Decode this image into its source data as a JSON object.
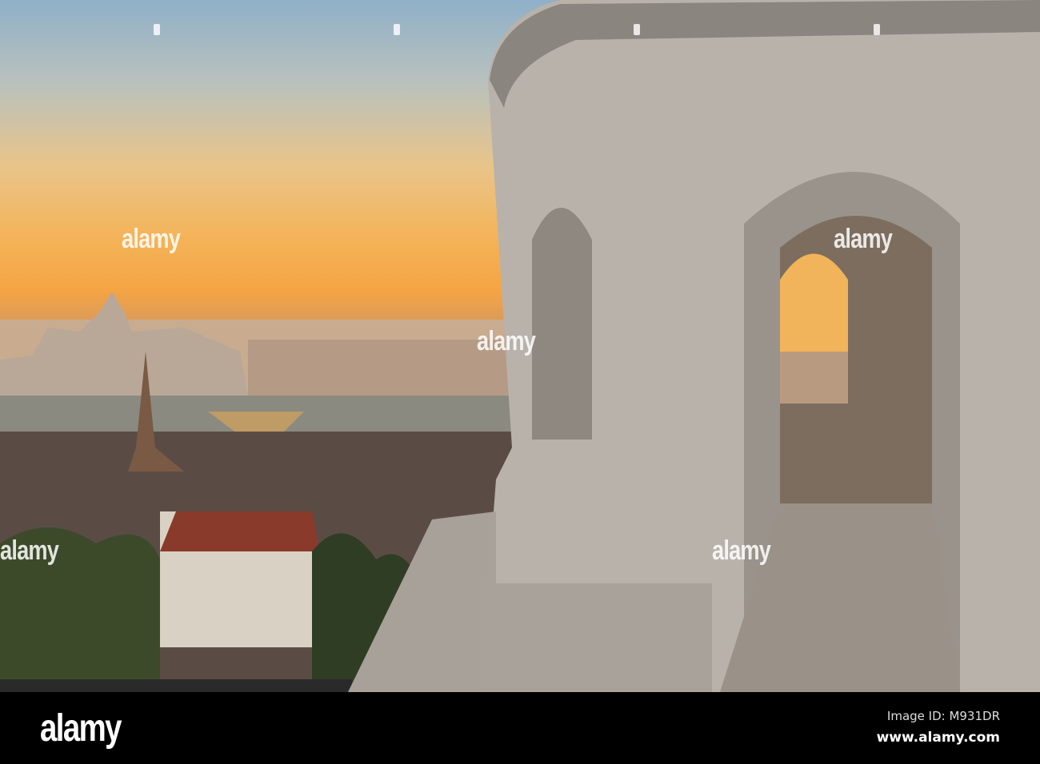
{
  "image": {
    "description_hidden": true
  },
  "watermark": {
    "text": "alamy"
  },
  "footer": {
    "logo": "alamy",
    "image_id": "Image ID: M931DR",
    "website": "www.alamy.com"
  }
}
